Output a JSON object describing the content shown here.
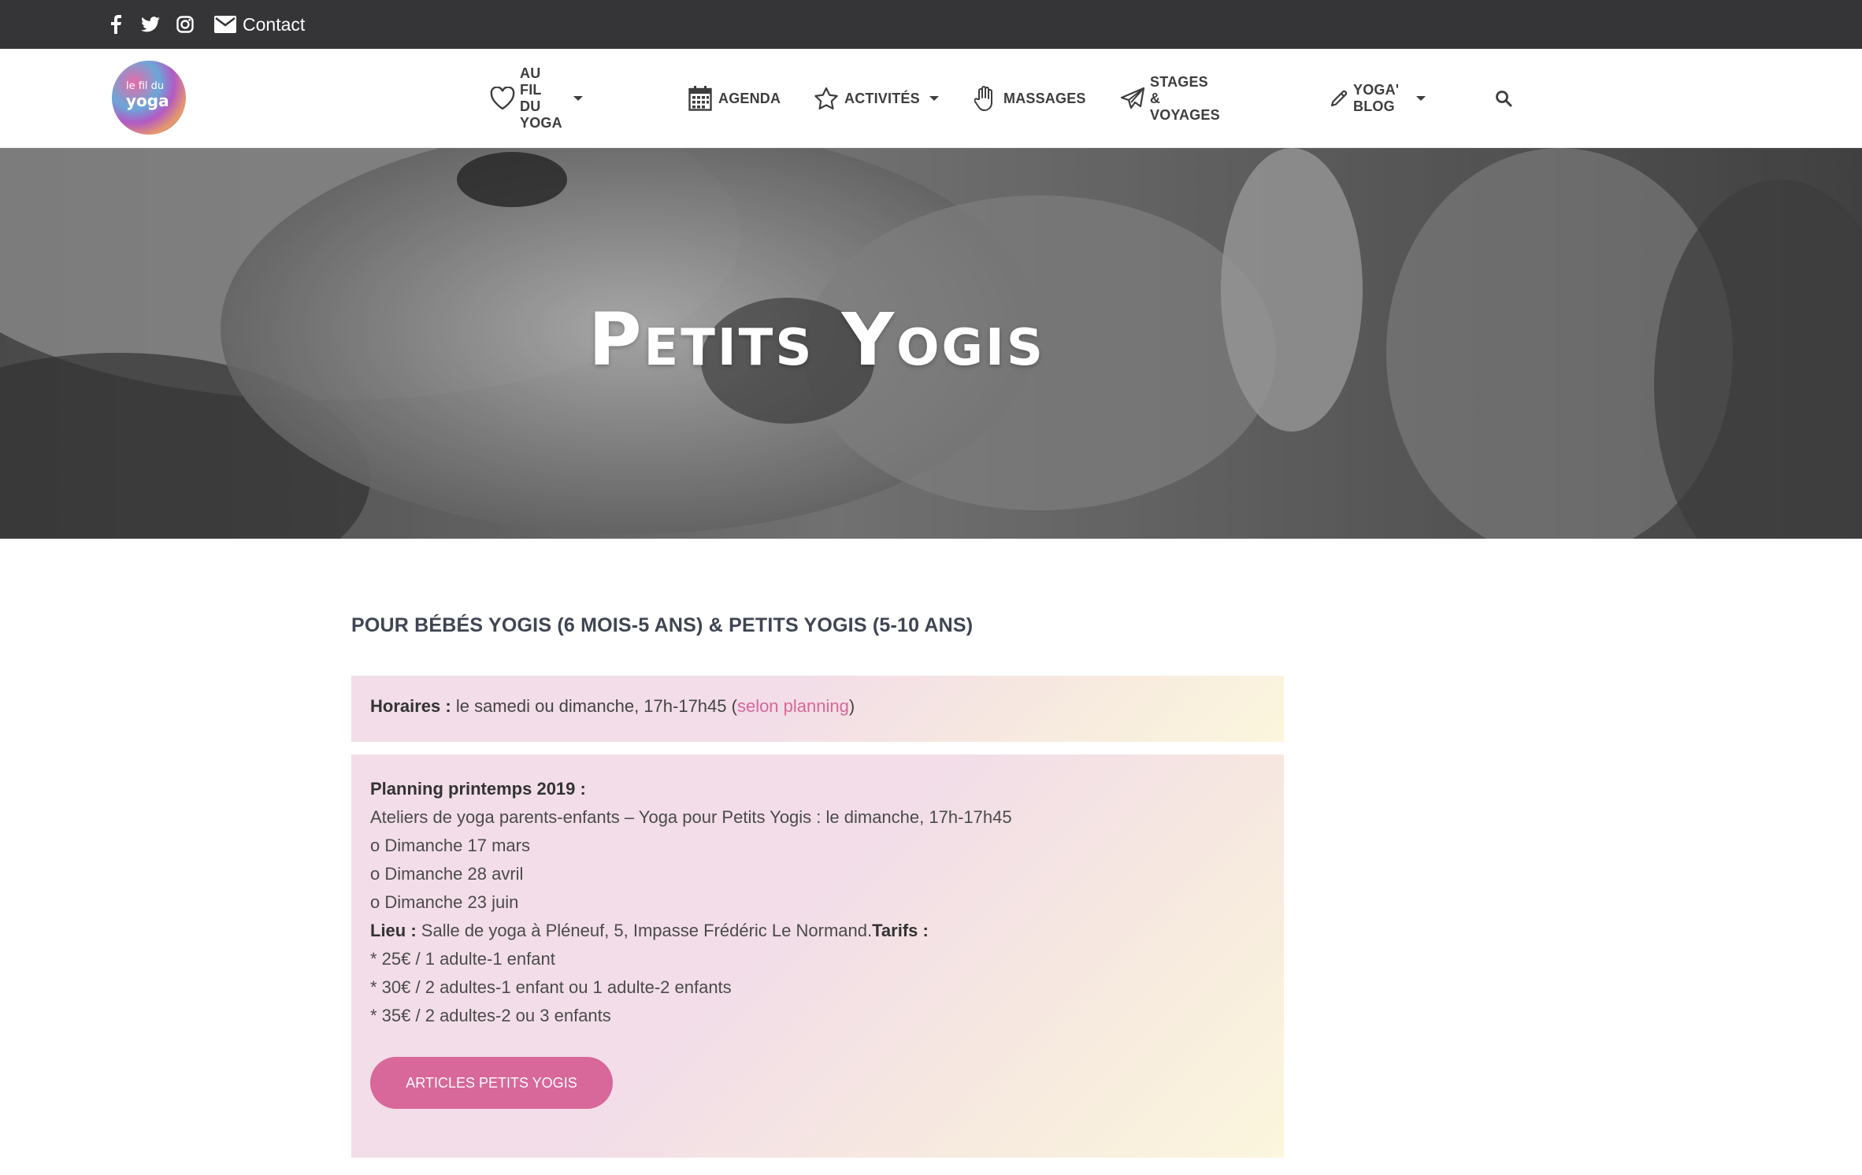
{
  "topbar": {
    "social": [
      {
        "icon": "facebook-icon"
      },
      {
        "icon": "twitter-icon"
      },
      {
        "icon": "instagram-icon"
      }
    ],
    "contact_label": "Contact"
  },
  "logo": {
    "line1": "le fil du",
    "line2": "yoga"
  },
  "nav": {
    "items": [
      {
        "label": "AU FIL DU YOGA",
        "icon": "heart-icon",
        "has_dropdown": true
      },
      {
        "label": "AGENDA",
        "icon": "calendar-icon",
        "has_dropdown": false
      },
      {
        "label": "ACTIVITÉS",
        "icon": "star-icon",
        "has_dropdown": true
      },
      {
        "label": "MASSAGES",
        "icon": "hand-icon",
        "has_dropdown": false
      },
      {
        "label": "STAGES & VOYAGES",
        "icon": "paper-plane-icon",
        "has_dropdown": false
      },
      {
        "label": "YOGA' BLOG",
        "icon": "pencil-icon",
        "has_dropdown": true
      }
    ],
    "search_icon": "search-icon"
  },
  "hero": {
    "title": "Petits Yogis"
  },
  "content": {
    "subtitle": "POUR BÉBÉS YOGIS (6 MOIS-5 ANS) & PETITS YOGIS (5-10 ANS)",
    "horaires": {
      "label": "Horaires :",
      "text": " le samedi ou dimanche, 17h-17h45 (",
      "link": "selon planning",
      "close": ")"
    },
    "planning": {
      "title": "Planning printemps 2019 :",
      "line1": "Ateliers de yoga parents-enfants – Yoga pour Petits Yogis : le dimanche, 17h-17h45",
      "dates": [
        "o Dimanche 17 mars",
        "o Dimanche 28 avril",
        "o Dimanche 23 juin"
      ],
      "lieu_label": "Lieu :",
      "lieu_text": " Salle de yoga à Pléneuf, 5, Impasse Frédéric Le Normand.",
      "tarifs_label": "Tarifs :",
      "tarifs": [
        "* 25€ / 1 adulte-1 enfant",
        "* 30€ / 2 adultes-1 enfant ou 1 adulte-2 enfants",
        "* 35€ / 2 adultes-2 ou 3 enfants"
      ]
    },
    "button_label": "ARTICLES PETITS YOGIS"
  },
  "colors": {
    "accent": "#d8679a",
    "topbar": "#353538"
  }
}
